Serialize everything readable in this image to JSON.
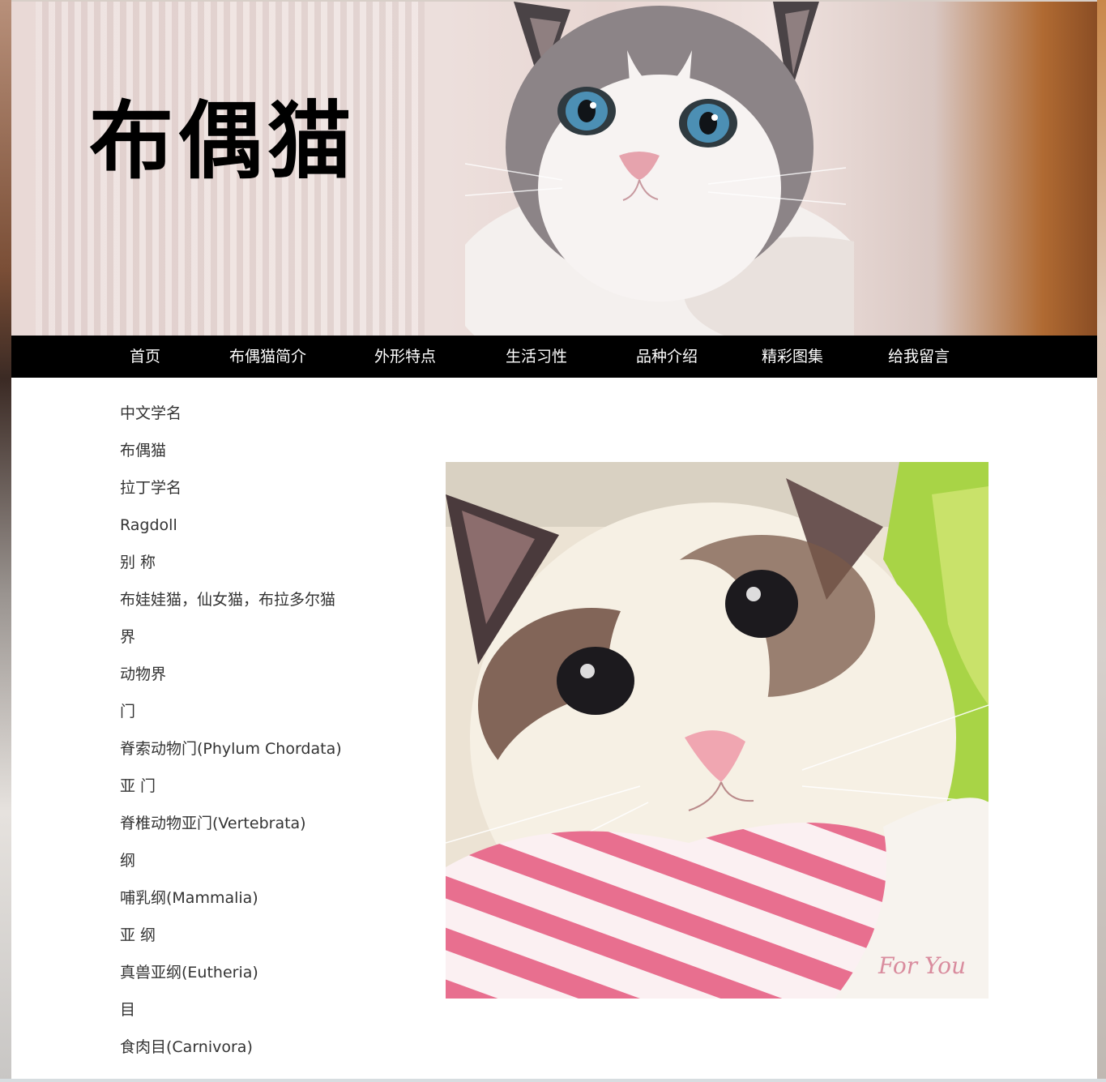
{
  "header": {
    "title": "布偶猫"
  },
  "nav": {
    "items": [
      {
        "label": "首页"
      },
      {
        "label": "布偶猫简介"
      },
      {
        "label": "外形特点"
      },
      {
        "label": "生活习性"
      },
      {
        "label": "品种介绍"
      },
      {
        "label": "精彩图集"
      },
      {
        "label": "给我留言"
      }
    ]
  },
  "info": {
    "lines": [
      "中文学名",
      "布偶猫",
      "拉丁学名",
      "Ragdoll",
      "别 称",
      "布娃娃猫，仙女猫，布拉多尔猫",
      "界",
      "动物界",
      "门",
      "脊索动物门(Phylum Chordata)",
      "亚 门",
      "脊椎动物亚门(Vertebrata)",
      "纲",
      "哺乳纲(Mammalia)",
      "亚 纲",
      "真兽亚纲(Eutheria)",
      "目",
      "食肉目(Carnivora)"
    ]
  },
  "photo": {
    "signature": "For You"
  }
}
